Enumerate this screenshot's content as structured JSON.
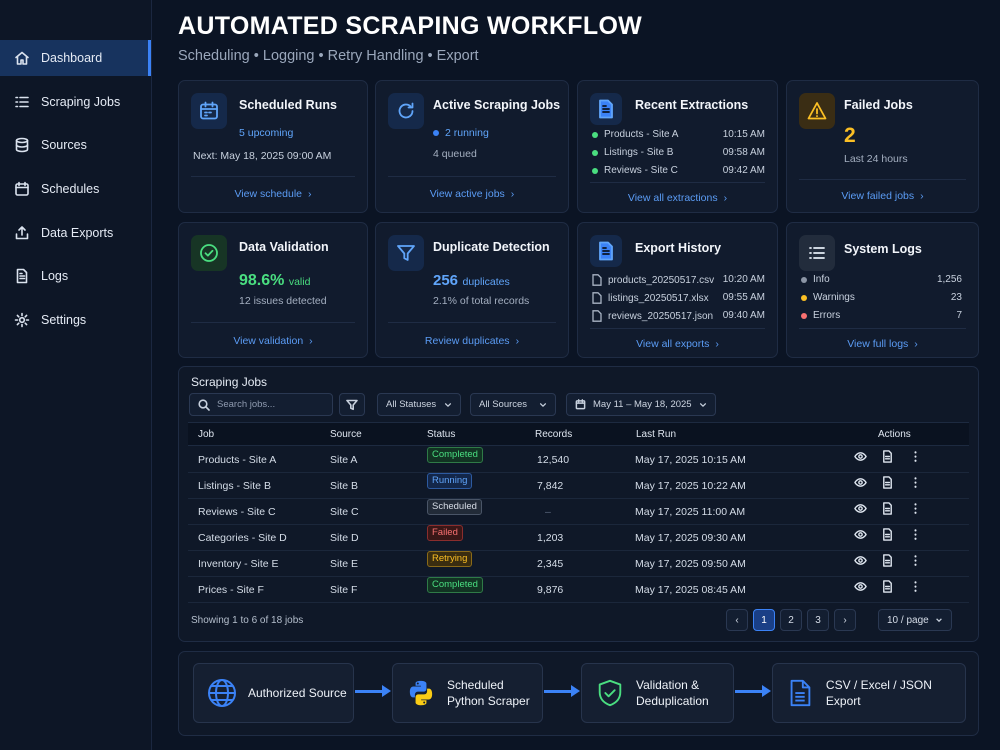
{
  "header": {
    "title": "AUTOMATED SCRAPING WORKFLOW",
    "subtitle": "Scheduling • Logging • Retry Handling • Export"
  },
  "sidebar": {
    "items": [
      {
        "label": "Dashboard",
        "icon": "home-icon",
        "active": true
      },
      {
        "label": "Scraping Jobs",
        "icon": "list-icon"
      },
      {
        "label": "Sources",
        "icon": "database-icon"
      },
      {
        "label": "Schedules",
        "icon": "calendar-icon"
      },
      {
        "label": "Data Exports",
        "icon": "export-icon"
      },
      {
        "label": "Logs",
        "icon": "document-icon"
      },
      {
        "label": "Settings",
        "icon": "gear-icon"
      }
    ]
  },
  "cards": {
    "scheduled": {
      "title": "Scheduled Runs",
      "upcoming": "5 upcoming",
      "next": "Next: May 18, 2025 09:00 AM",
      "link": "View schedule"
    },
    "active": {
      "title": "Active Scraping Jobs",
      "running": "2 running",
      "queued": "4 queued",
      "link": "View active jobs"
    },
    "extractions": {
      "title": "Recent Extractions",
      "items": [
        {
          "name": "Products - Site A",
          "time": "10:15 AM"
        },
        {
          "name": "Listings - Site B",
          "time": "09:58 AM"
        },
        {
          "name": "Reviews - Site C",
          "time": "09:42 AM"
        }
      ],
      "link": "View all extractions"
    },
    "failed": {
      "title": "Failed Jobs",
      "count": "2",
      "period": "Last 24 hours",
      "link": "View failed jobs"
    },
    "validation": {
      "title": "Data Validation",
      "percent": "98.6%",
      "valid_label": "valid",
      "issues": "12 issues detected",
      "link": "View validation"
    },
    "duplicates": {
      "title": "Duplicate Detection",
      "count": "256",
      "count_label": "duplicates",
      "share": "2.1% of total records",
      "link": "Review duplicates"
    },
    "exports": {
      "title": "Export History",
      "items": [
        {
          "file": "products_20250517.csv",
          "time": "10:20 AM"
        },
        {
          "file": "listings_20250517.xlsx",
          "time": "09:55 AM"
        },
        {
          "file": "reviews_20250517.json",
          "time": "09:40 AM"
        }
      ],
      "link": "View all exports"
    },
    "logs": {
      "title": "System Logs",
      "items": [
        {
          "level": "Info",
          "count": "1,256",
          "color": "#8b95a5"
        },
        {
          "level": "Warnings",
          "count": "23",
          "color": "#fbbf24"
        },
        {
          "level": "Errors",
          "count": "7",
          "color": "#f87171"
        }
      ],
      "link": "View full logs"
    }
  },
  "jobs": {
    "title": "Scraping Jobs",
    "search_placeholder": "Search jobs...",
    "status_filter": "All Statuses",
    "source_filter": "All Sources",
    "date_range": "May 11 – May 18, 2025",
    "columns": {
      "job": "Job",
      "source": "Source",
      "status": "Status",
      "records": "Records",
      "last_run": "Last Run",
      "actions": "Actions"
    },
    "rows": [
      {
        "job": "Products - Site A",
        "source": "Site A",
        "status": "Completed",
        "records": "12,540",
        "last_run": "May 17, 2025 10:15 AM"
      },
      {
        "job": "Listings - Site B",
        "source": "Site B",
        "status": "Running",
        "records": "7,842",
        "last_run": "May 17, 2025 10:22 AM"
      },
      {
        "job": "Reviews - Site C",
        "source": "Site C",
        "status": "Scheduled",
        "records": "–",
        "last_run": "May 17, 2025 11:00 AM"
      },
      {
        "job": "Categories - Site D",
        "source": "Site D",
        "status": "Failed",
        "records": "1,203",
        "last_run": "May 17, 2025 09:30 AM"
      },
      {
        "job": "Inventory - Site E",
        "source": "Site E",
        "status": "Retrying",
        "records": "2,345",
        "last_run": "May 17, 2025 09:50 AM"
      },
      {
        "job": "Prices - Site F",
        "source": "Site F",
        "status": "Completed",
        "records": "9,876",
        "last_run": "May 17, 2025 08:45 AM"
      }
    ],
    "showing": "Showing 1 to 6 of 18 jobs",
    "pages": [
      "1",
      "2",
      "3"
    ],
    "prev": "‹",
    "next": "›",
    "page_size": "10 / page"
  },
  "workflow": {
    "steps": [
      {
        "label": "Authorized Source",
        "icon": "globe-icon"
      },
      {
        "label": "Scheduled\nPython Scraper",
        "icon": "python-icon"
      },
      {
        "label": "Validation &\nDeduplication",
        "icon": "shield-check-icon"
      },
      {
        "label": "CSV / Excel / JSON Export",
        "icon": "file-icon"
      }
    ]
  }
}
